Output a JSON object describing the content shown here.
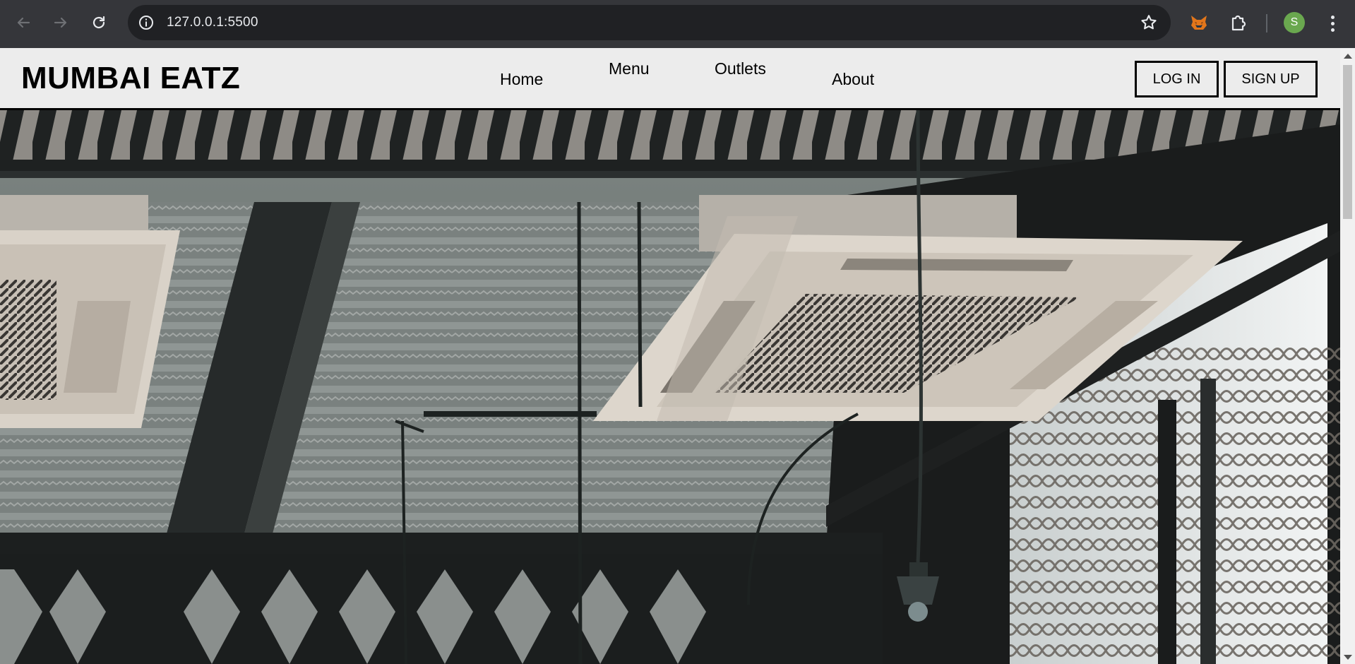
{
  "browser": {
    "url": "127.0.0.1:5500",
    "profile_initial": "S",
    "icons": {
      "back": "back-arrow-icon",
      "forward": "forward-arrow-icon",
      "reload": "reload-icon",
      "site_info": "info-icon",
      "bookmark": "star-icon",
      "extension_1": "fox-extension-icon",
      "extensions": "puzzle-icon",
      "menu": "kebab-menu-icon"
    }
  },
  "site": {
    "logo": "MUMBAI EATZ",
    "nav": {
      "home": "Home",
      "menu": "Menu",
      "outlets": "Outlets",
      "about": "About"
    },
    "login_label": "LOG IN",
    "signup_label": "SIGN UP"
  },
  "colors": {
    "header_bg": "#ececec",
    "chrome_bg": "#35363a",
    "omnibox_bg": "#202124",
    "avatar_bg": "#6aa84f"
  }
}
